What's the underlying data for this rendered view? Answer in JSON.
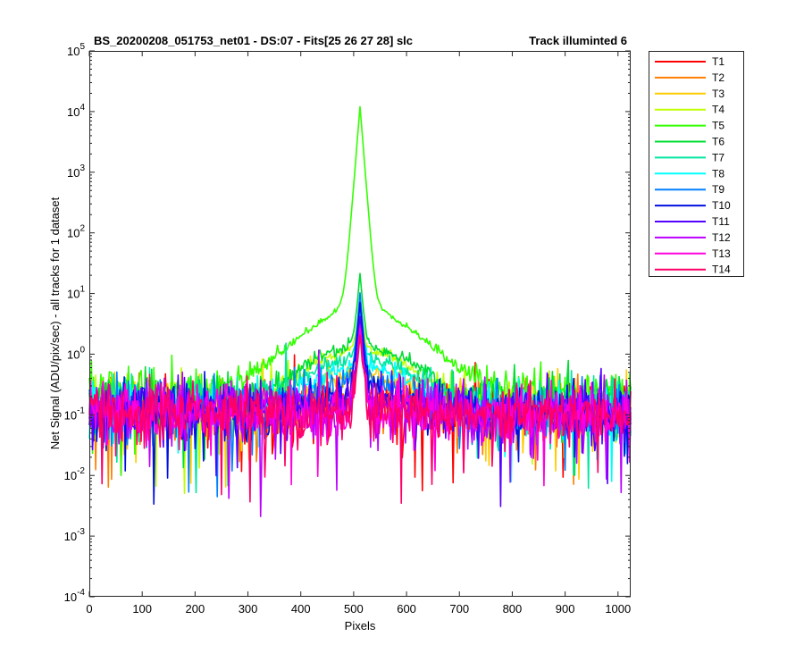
{
  "chart_data": {
    "type": "line",
    "title_left": "BS_20200208_051753_net01 - DS:07 - Fits[25  26  27  28]   slc",
    "title_right": "Track illuminted 6",
    "xlabel": "Pixels",
    "ylabel": "Net Signal (ADU/pix/sec) - all tracks for 1 dataset",
    "xlim": [
      0,
      1024
    ],
    "ylim": [
      0.0001,
      100000
    ],
    "y_scale": "log",
    "x_ticks": [
      0,
      100,
      200,
      300,
      400,
      500,
      600,
      700,
      800,
      900,
      1000
    ],
    "y_tick_labels": [
      {
        "base": "10",
        "exp": "-4"
      },
      {
        "base": "10",
        "exp": "-3"
      },
      {
        "base": "10",
        "exp": "-2"
      },
      {
        "base": "10",
        "exp": "-1"
      },
      {
        "base": "10",
        "exp": "0"
      },
      {
        "base": "10",
        "exp": "1"
      },
      {
        "base": "10",
        "exp": "2"
      },
      {
        "base": "10",
        "exp": "3"
      },
      {
        "base": "10",
        "exp": "4"
      },
      {
        "base": "10",
        "exp": "5"
      }
    ],
    "grid": false,
    "legend_position": "outside-right-top",
    "peak_pixel": 512,
    "series": [
      {
        "name": "T1",
        "color": "#ff0000",
        "baseline": 0.12,
        "wing": 0.0,
        "peak": 3.0
      },
      {
        "name": "T2",
        "color": "#ff7f00",
        "baseline": 0.12,
        "wing": 0.05,
        "peak": 3.5
      },
      {
        "name": "T3",
        "color": "#ffcc00",
        "baseline": 0.13,
        "wing": 0.3,
        "peak": 4.0
      },
      {
        "name": "T4",
        "color": "#bfff00",
        "baseline": 0.15,
        "wing": 1.0,
        "peak": 8.0
      },
      {
        "name": "T5",
        "color": "#33ff00",
        "baseline": 0.2,
        "wing": 1.8,
        "peak": 12000
      },
      {
        "name": "T6",
        "color": "#00dd33",
        "baseline": 0.15,
        "wing": 1.2,
        "peak": 20.0
      },
      {
        "name": "T7",
        "color": "#00e6a0",
        "baseline": 0.13,
        "wing": 0.7,
        "peak": 6.0
      },
      {
        "name": "T8",
        "color": "#00ffff",
        "baseline": 0.12,
        "wing": 0.45,
        "peak": 5.0
      },
      {
        "name": "T9",
        "color": "#0080ff",
        "baseline": 0.12,
        "wing": 0.2,
        "peak": 10.0
      },
      {
        "name": "T10",
        "color": "#0010e0",
        "baseline": 0.11,
        "wing": 0.1,
        "peak": 7.0
      },
      {
        "name": "T11",
        "color": "#5500ff",
        "baseline": 0.11,
        "wing": 0.05,
        "peak": 4.0
      },
      {
        "name": "T12",
        "color": "#bb00ff",
        "baseline": 0.11,
        "wing": 0.0,
        "peak": 3.0
      },
      {
        "name": "T13",
        "color": "#ff00dd",
        "baseline": 0.11,
        "wing": 0.0,
        "peak": 2.5
      },
      {
        "name": "T14",
        "color": "#ff0066",
        "baseline": 0.11,
        "wing": 0.0,
        "peak": 2.0
      }
    ]
  }
}
